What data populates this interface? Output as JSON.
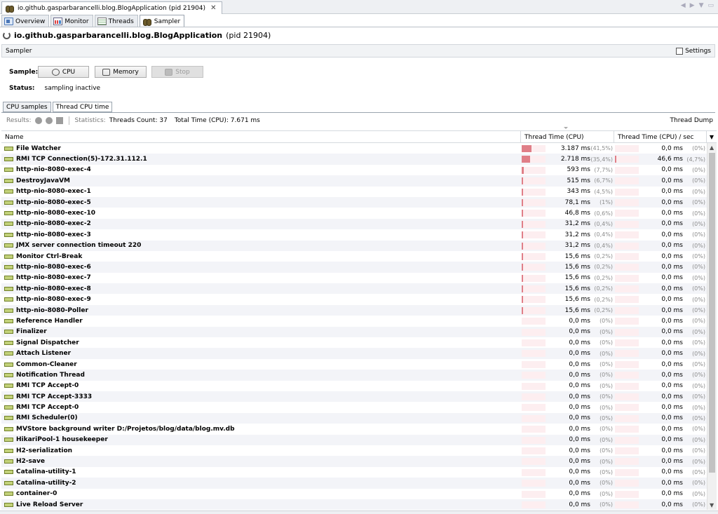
{
  "document_tab": {
    "title": "io.github.gasparbarancelli.blog.BlogApplication (pid 21904)",
    "close": "✕"
  },
  "nav_arrows": {
    "left": "◀",
    "right": "▶",
    "menu": "▼",
    "restore": "▭"
  },
  "view_tabs": [
    {
      "label": "Overview",
      "icon": "overview-icon"
    },
    {
      "label": "Monitor",
      "icon": "monitor-icon"
    },
    {
      "label": "Threads",
      "icon": "threads-icon"
    },
    {
      "label": "Sampler",
      "icon": "sampler-icon",
      "active": true
    }
  ],
  "app": {
    "name": "io.github.gasparbarancelli.blog.BlogApplication",
    "pid": "(pid 21904)"
  },
  "sampler_bar": {
    "title": "Sampler",
    "settings_label": "Settings"
  },
  "sample": {
    "label": "Sample:",
    "cpu_button": "CPU",
    "memory_button": "Memory",
    "stop_button": "Stop"
  },
  "status": {
    "label": "Status:",
    "value": "sampling inactive"
  },
  "sub_tabs": [
    {
      "label": "CPU samples"
    },
    {
      "label": "Thread CPU time",
      "active": true
    }
  ],
  "results": {
    "label": "Results:",
    "statistics_label": "Statistics:",
    "threads_count": "Threads Count: 37",
    "total_time": "Total Time (CPU): 7.671 ms",
    "thread_dump": "Thread Dump"
  },
  "columns": {
    "name": "Name",
    "cpu": "Thread Time (CPU)",
    "cpu_sec": "Thread Time (CPU) / sec",
    "menu": "▼"
  },
  "rows": [
    {
      "name": "File Watcher",
      "cpu": "3.187 ms",
      "cpu_pct": "(41,5%)",
      "cpu_frac": 0.415,
      "sec": "0,0 ms",
      "sec_pct": "(0%)",
      "sec_frac": 0
    },
    {
      "name": "RMI TCP Connection(5)-172.31.112.1",
      "cpu": "2.718 ms",
      "cpu_pct": "(35,4%)",
      "cpu_frac": 0.354,
      "sec": "46,6 ms",
      "sec_pct": "(4,7%)",
      "sec_frac": 0.047
    },
    {
      "name": "http-nio-8080-exec-4",
      "cpu": "593 ms",
      "cpu_pct": "(7,7%)",
      "cpu_frac": 0.077,
      "sec": "0,0 ms",
      "sec_pct": "(0%)",
      "sec_frac": 0
    },
    {
      "name": "DestroyJavaVM",
      "cpu": "515 ms",
      "cpu_pct": "(6,7%)",
      "cpu_frac": 0.067,
      "sec": "0,0 ms",
      "sec_pct": "(0%)",
      "sec_frac": 0
    },
    {
      "name": "http-nio-8080-exec-1",
      "cpu": "343 ms",
      "cpu_pct": "(4,5%)",
      "cpu_frac": 0.045,
      "sec": "0,0 ms",
      "sec_pct": "(0%)",
      "sec_frac": 0
    },
    {
      "name": "http-nio-8080-exec-5",
      "cpu": "78,1 ms",
      "cpu_pct": "(1%)",
      "cpu_frac": 0.01,
      "sec": "0,0 ms",
      "sec_pct": "(0%)",
      "sec_frac": 0
    },
    {
      "name": "http-nio-8080-exec-10",
      "cpu": "46,8 ms",
      "cpu_pct": "(0,6%)",
      "cpu_frac": 0.006,
      "sec": "0,0 ms",
      "sec_pct": "(0%)",
      "sec_frac": 0
    },
    {
      "name": "http-nio-8080-exec-2",
      "cpu": "31,2 ms",
      "cpu_pct": "(0,4%)",
      "cpu_frac": 0.004,
      "sec": "0,0 ms",
      "sec_pct": "(0%)",
      "sec_frac": 0
    },
    {
      "name": "http-nio-8080-exec-3",
      "cpu": "31,2 ms",
      "cpu_pct": "(0,4%)",
      "cpu_frac": 0.004,
      "sec": "0,0 ms",
      "sec_pct": "(0%)",
      "sec_frac": 0
    },
    {
      "name": "JMX server connection timeout 220",
      "cpu": "31,2 ms",
      "cpu_pct": "(0,4%)",
      "cpu_frac": 0.004,
      "sec": "0,0 ms",
      "sec_pct": "(0%)",
      "sec_frac": 0
    },
    {
      "name": "Monitor Ctrl-Break",
      "cpu": "15,6 ms",
      "cpu_pct": "(0,2%)",
      "cpu_frac": 0.002,
      "sec": "0,0 ms",
      "sec_pct": "(0%)",
      "sec_frac": 0
    },
    {
      "name": "http-nio-8080-exec-6",
      "cpu": "15,6 ms",
      "cpu_pct": "(0,2%)",
      "cpu_frac": 0.002,
      "sec": "0,0 ms",
      "sec_pct": "(0%)",
      "sec_frac": 0
    },
    {
      "name": "http-nio-8080-exec-7",
      "cpu": "15,6 ms",
      "cpu_pct": "(0,2%)",
      "cpu_frac": 0.002,
      "sec": "0,0 ms",
      "sec_pct": "(0%)",
      "sec_frac": 0
    },
    {
      "name": "http-nio-8080-exec-8",
      "cpu": "15,6 ms",
      "cpu_pct": "(0,2%)",
      "cpu_frac": 0.002,
      "sec": "0,0 ms",
      "sec_pct": "(0%)",
      "sec_frac": 0
    },
    {
      "name": "http-nio-8080-exec-9",
      "cpu": "15,6 ms",
      "cpu_pct": "(0,2%)",
      "cpu_frac": 0.002,
      "sec": "0,0 ms",
      "sec_pct": "(0%)",
      "sec_frac": 0
    },
    {
      "name": "http-nio-8080-Poller",
      "cpu": "15,6 ms",
      "cpu_pct": "(0,2%)",
      "cpu_frac": 0.002,
      "sec": "0,0 ms",
      "sec_pct": "(0%)",
      "sec_frac": 0
    },
    {
      "name": "Reference Handler",
      "cpu": "0,0 ms",
      "cpu_pct": "(0%)",
      "cpu_frac": 0,
      "sec": "0,0 ms",
      "sec_pct": "(0%)",
      "sec_frac": 0
    },
    {
      "name": "Finalizer",
      "cpu": "0,0 ms",
      "cpu_pct": "(0%)",
      "cpu_frac": 0,
      "sec": "0,0 ms",
      "sec_pct": "(0%)",
      "sec_frac": 0
    },
    {
      "name": "Signal Dispatcher",
      "cpu": "0,0 ms",
      "cpu_pct": "(0%)",
      "cpu_frac": 0,
      "sec": "0,0 ms",
      "sec_pct": "(0%)",
      "sec_frac": 0
    },
    {
      "name": "Attach Listener",
      "cpu": "0,0 ms",
      "cpu_pct": "(0%)",
      "cpu_frac": 0,
      "sec": "0,0 ms",
      "sec_pct": "(0%)",
      "sec_frac": 0
    },
    {
      "name": "Common-Cleaner",
      "cpu": "0,0 ms",
      "cpu_pct": "(0%)",
      "cpu_frac": 0,
      "sec": "0,0 ms",
      "sec_pct": "(0%)",
      "sec_frac": 0
    },
    {
      "name": "Notification Thread",
      "cpu": "0,0 ms",
      "cpu_pct": "(0%)",
      "cpu_frac": 0,
      "sec": "0,0 ms",
      "sec_pct": "(0%)",
      "sec_frac": 0
    },
    {
      "name": "RMI TCP Accept-0",
      "cpu": "0,0 ms",
      "cpu_pct": "(0%)",
      "cpu_frac": 0,
      "sec": "0,0 ms",
      "sec_pct": "(0%)",
      "sec_frac": 0
    },
    {
      "name": "RMI TCP Accept-3333",
      "cpu": "0,0 ms",
      "cpu_pct": "(0%)",
      "cpu_frac": 0,
      "sec": "0,0 ms",
      "sec_pct": "(0%)",
      "sec_frac": 0
    },
    {
      "name": "RMI TCP Accept-0",
      "cpu": "0,0 ms",
      "cpu_pct": "(0%)",
      "cpu_frac": 0,
      "sec": "0,0 ms",
      "sec_pct": "(0%)",
      "sec_frac": 0
    },
    {
      "name": "RMI Scheduler(0)",
      "cpu": "0,0 ms",
      "cpu_pct": "(0%)",
      "cpu_frac": 0,
      "sec": "0,0 ms",
      "sec_pct": "(0%)",
      "sec_frac": 0
    },
    {
      "name": "MVStore background writer D:/Projetos/blog/data/blog.mv.db",
      "cpu": "0,0 ms",
      "cpu_pct": "(0%)",
      "cpu_frac": 0,
      "sec": "0,0 ms",
      "sec_pct": "(0%)",
      "sec_frac": 0
    },
    {
      "name": "HikariPool-1 housekeeper",
      "cpu": "0,0 ms",
      "cpu_pct": "(0%)",
      "cpu_frac": 0,
      "sec": "0,0 ms",
      "sec_pct": "(0%)",
      "sec_frac": 0
    },
    {
      "name": "H2-serialization",
      "cpu": "0,0 ms",
      "cpu_pct": "(0%)",
      "cpu_frac": 0,
      "sec": "0,0 ms",
      "sec_pct": "(0%)",
      "sec_frac": 0
    },
    {
      "name": "H2-save",
      "cpu": "0,0 ms",
      "cpu_pct": "(0%)",
      "cpu_frac": 0,
      "sec": "0,0 ms",
      "sec_pct": "(0%)",
      "sec_frac": 0
    },
    {
      "name": "Catalina-utility-1",
      "cpu": "0,0 ms",
      "cpu_pct": "(0%)",
      "cpu_frac": 0,
      "sec": "0,0 ms",
      "sec_pct": "(0%)",
      "sec_frac": 0
    },
    {
      "name": "Catalina-utility-2",
      "cpu": "0,0 ms",
      "cpu_pct": "(0%)",
      "cpu_frac": 0,
      "sec": "0,0 ms",
      "sec_pct": "(0%)",
      "sec_frac": 0
    },
    {
      "name": "container-0",
      "cpu": "0,0 ms",
      "cpu_pct": "(0%)",
      "cpu_frac": 0,
      "sec": "0,0 ms",
      "sec_pct": "(0%)",
      "sec_frac": 0
    },
    {
      "name": "Live Reload Server",
      "cpu": "0,0 ms",
      "cpu_pct": "(0%)",
      "cpu_frac": 0,
      "sec": "0,0 ms",
      "sec_pct": "(0%)",
      "sec_frac": 0
    }
  ],
  "scrollbar": {
    "up": "▲",
    "down": "▼"
  },
  "colors": {
    "bar_fill": "#e07f88",
    "bar_bg": "#fdeef0",
    "thread_icon": "#c3d27a"
  }
}
